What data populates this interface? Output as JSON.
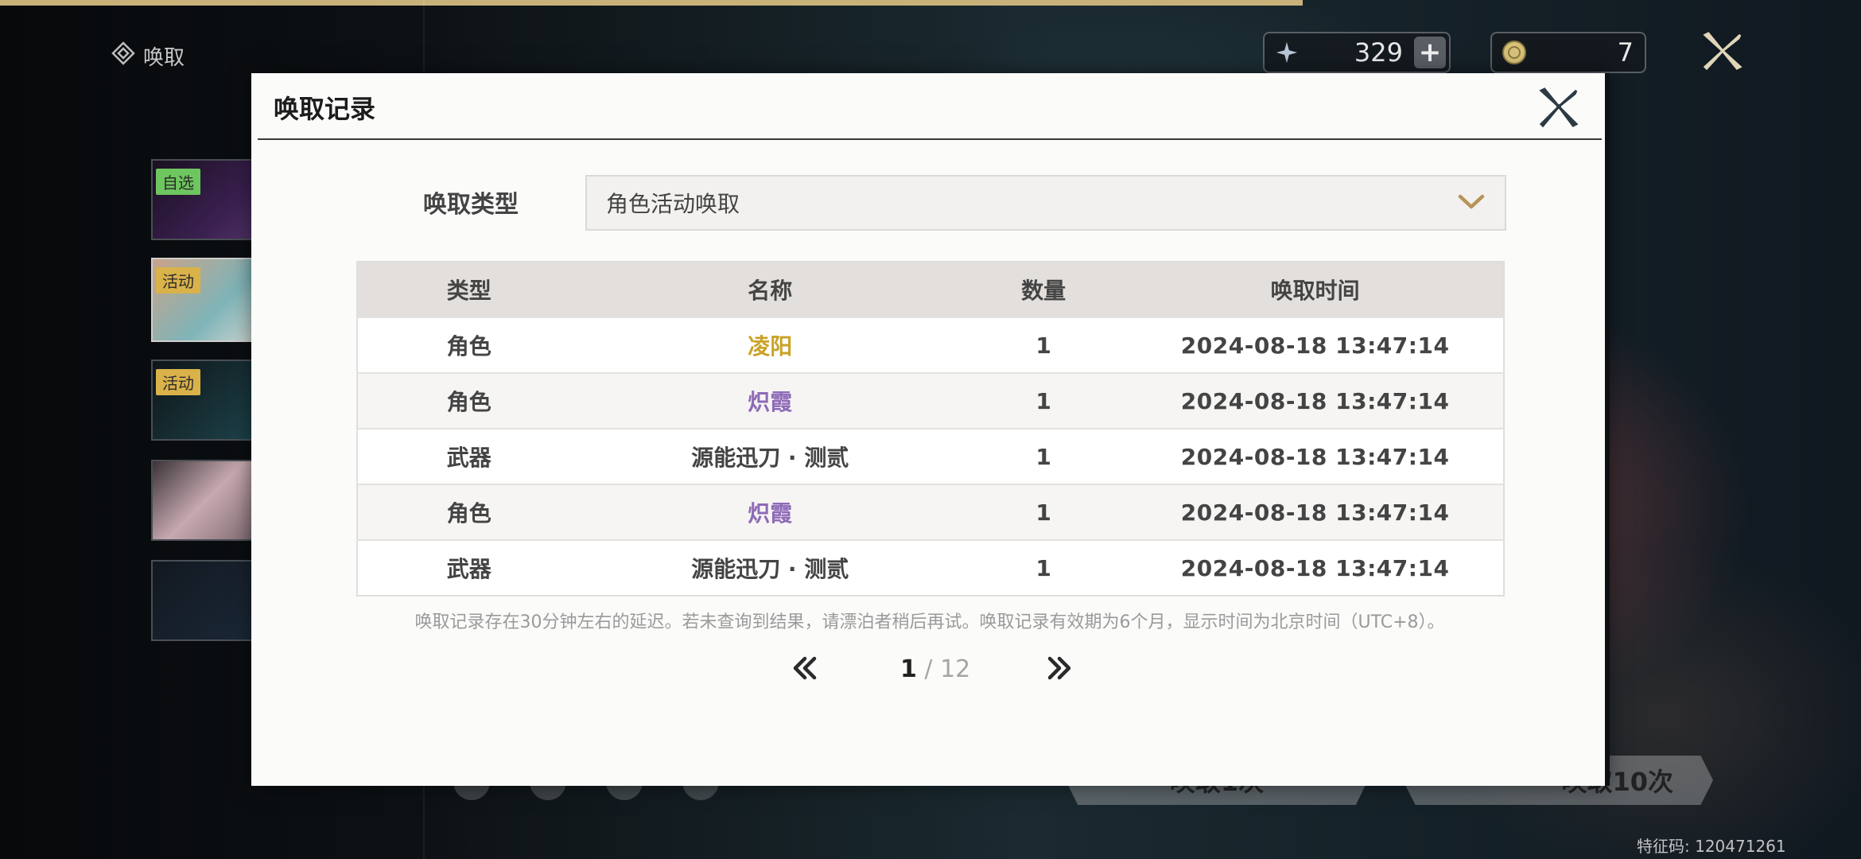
{
  "page": {
    "label": "唤取"
  },
  "banners": [
    {
      "tag": "自选",
      "tag_color": "#6ec65f"
    },
    {
      "tag": "活动",
      "tag_color": "#d9b24a"
    },
    {
      "tag": "活动",
      "tag_color": "#d9b24a"
    },
    {
      "tag": ""
    },
    {
      "tag": ""
    }
  ],
  "currency": {
    "astrite": {
      "icon": "astrite-icon",
      "value": "329"
    },
    "tide": {
      "icon": "radiant-tide-icon",
      "value": "7"
    }
  },
  "background": {
    "pull_once_label": "唤取1次",
    "pull_ten_label": "唤取10次",
    "feature_code": "特征码: 120471261"
  },
  "modal": {
    "title": "唤取记录",
    "type_label": "唤取类型",
    "type_value": "角色活动唤取",
    "columns": {
      "type": "类型",
      "name": "名称",
      "qty": "数量",
      "time": "唤取时间"
    },
    "rows": [
      {
        "type": "角色",
        "name": "凌阳",
        "qty": "1",
        "time": "2024-08-18 13:47:14",
        "rarity_color": "#c9a227"
      },
      {
        "type": "角色",
        "name": "炽霞",
        "qty": "1",
        "time": "2024-08-18 13:47:14",
        "rarity_color": "#8e6bb8"
      },
      {
        "type": "武器",
        "name": "源能迅刀 · 测贰",
        "qty": "1",
        "time": "2024-08-18 13:47:14",
        "rarity_color": "#444444"
      },
      {
        "type": "角色",
        "name": "炽霞",
        "qty": "1",
        "time": "2024-08-18 13:47:14",
        "rarity_color": "#8e6bb8"
      },
      {
        "type": "武器",
        "name": "源能迅刀 · 测贰",
        "qty": "1",
        "time": "2024-08-18 13:47:14",
        "rarity_color": "#444444"
      }
    ],
    "notice": "唤取记录存在30分钟左右的延迟。若未查询到结果，请漂泊者稍后再试。唤取记录有效期为6个月，显示时间为北京时间（UTC+8）。",
    "pagination": {
      "current": "1",
      "separator": " / ",
      "total": "12"
    }
  }
}
